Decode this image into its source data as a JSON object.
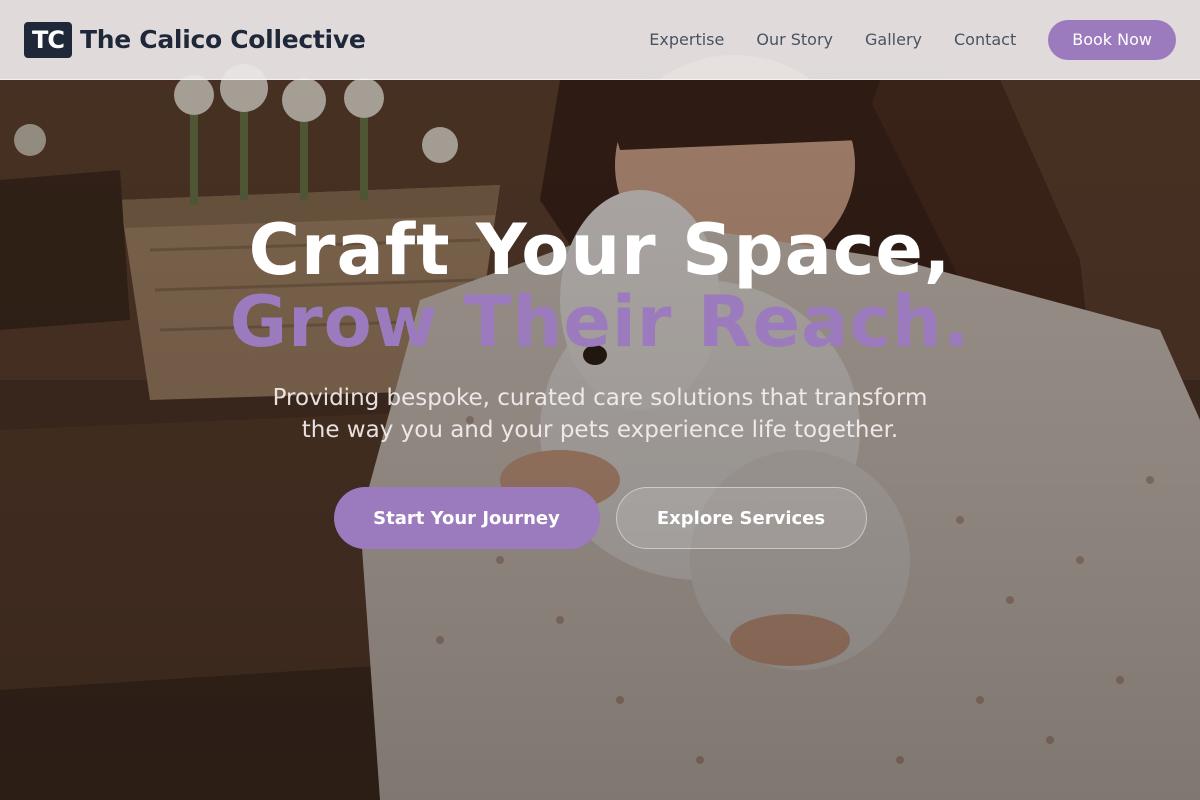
{
  "brand": {
    "logo_text": "TC",
    "name": "The Calico Collective"
  },
  "nav": {
    "items": [
      {
        "label": "Expertise"
      },
      {
        "label": "Our Story"
      },
      {
        "label": "Gallery"
      },
      {
        "label": "Contact"
      }
    ],
    "cta_label": "Book Now"
  },
  "hero": {
    "headline_line1": "Craft Your Space,",
    "headline_line2": "Grow Their Reach.",
    "subtext": "Providing bespoke, curated care solutions that transform the way you and your pets experience life together.",
    "primary_cta": "Start Your Journey",
    "secondary_cta": "Explore Services"
  },
  "colors": {
    "accent": "#9b7bbd",
    "brand_dark": "#1f2838",
    "nav_text": "#4a5262",
    "header_bg": "#ece8e8"
  }
}
